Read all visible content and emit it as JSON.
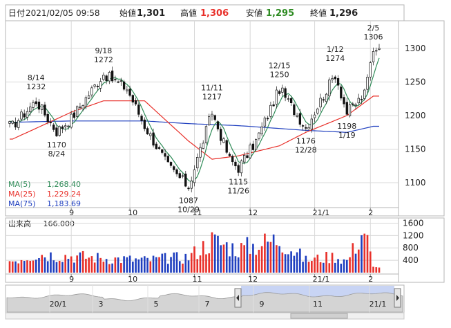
{
  "header": {
    "date_label": "日付",
    "datetime": "2021/02/05 09:58",
    "open_label": "始値",
    "open": "1,301",
    "high_label": "高値",
    "high": "1,306",
    "low_label": "安値",
    "low": "1,295",
    "close_label": "終値",
    "close": "1,296"
  },
  "legend": [
    {
      "label": "MA(5)",
      "value": "1,268.40",
      "color": "#2e8b57"
    },
    {
      "label": "MA(25)",
      "value": "1,229.24",
      "color": "#e8302a"
    },
    {
      "label": "MA(75)",
      "value": "1,183.69",
      "color": "#1f3fbf"
    }
  ],
  "volume_panel": {
    "title": "出来高",
    "value": "166.000"
  },
  "navigator": {
    "labels": [
      "20/1",
      "3",
      "5",
      "7",
      "9",
      "11",
      "21/1"
    ]
  },
  "colors": {
    "up": "#e8302a",
    "down": "#1f3fbf",
    "ma5": "#2e8b57",
    "ma25": "#e8302a",
    "ma75": "#1f3fbf",
    "frame": "#b4b4b4",
    "grid": "#d8d8d8"
  },
  "chart_data": [
    {
      "type": "candlestick",
      "x_ticks": [
        "9",
        "10",
        "11",
        "12",
        "21/1",
        "2"
      ],
      "y_ticks": [
        1100,
        1150,
        1200,
        1250,
        1300
      ],
      "ylim": [
        1065,
        1335
      ],
      "annotations": [
        {
          "date": "8/14",
          "value": 1232,
          "text": [
            "8/14",
            "1232"
          ],
          "pos": "above"
        },
        {
          "date": "8/24",
          "value": 1170,
          "text": [
            "1170",
            "8/24"
          ],
          "pos": "below"
        },
        {
          "date": "9/18",
          "value": 1272,
          "text": [
            "9/18",
            "1272"
          ],
          "pos": "above"
        },
        {
          "date": "10/29",
          "value": 1087,
          "text": [
            "1087",
            "10/29"
          ],
          "pos": "below"
        },
        {
          "date": "11/11",
          "value": 1217,
          "text": [
            "11/11",
            "1217"
          ],
          "pos": "above"
        },
        {
          "date": "11/26",
          "value": 1115,
          "text": [
            "1115",
            "11/26"
          ],
          "pos": "below"
        },
        {
          "date": "12/15",
          "value": 1250,
          "text": [
            "12/15",
            "1250"
          ],
          "pos": "above"
        },
        {
          "date": "12/28",
          "value": 1176,
          "text": [
            "1176",
            "12/28"
          ],
          "pos": "below"
        },
        {
          "date": "1/12",
          "value": 1274,
          "text": [
            "1/12",
            "1274"
          ],
          "pos": "above"
        },
        {
          "date": "1/19",
          "value": 1198,
          "text": [
            "1198",
            "1/19"
          ],
          "pos": "below"
        },
        {
          "date": "2/5",
          "value": 1306,
          "text": [
            "2/5",
            "1306"
          ],
          "pos": "above"
        }
      ],
      "anchors": [
        {
          "date": "8/3",
          "value": 1185
        },
        {
          "date": "8/14",
          "value": 1222
        },
        {
          "date": "8/24",
          "value": 1176
        },
        {
          "date": "9/1",
          "value": 1196
        },
        {
          "date": "9/18",
          "value": 1262
        },
        {
          "date": "9/30",
          "value": 1240
        },
        {
          "date": "10/8",
          "value": 1185
        },
        {
          "date": "10/20",
          "value": 1125
        },
        {
          "date": "10/29",
          "value": 1094
        },
        {
          "date": "11/11",
          "value": 1205
        },
        {
          "date": "11/20",
          "value": 1135
        },
        {
          "date": "11/26",
          "value": 1122
        },
        {
          "date": "12/4",
          "value": 1162
        },
        {
          "date": "12/15",
          "value": 1240
        },
        {
          "date": "12/28",
          "value": 1182
        },
        {
          "date": "1/12",
          "value": 1262
        },
        {
          "date": "1/19",
          "value": 1204
        },
        {
          "date": "1/28",
          "value": 1232
        },
        {
          "date": "2/5",
          "value": 1300
        }
      ],
      "ma25_approx": [
        {
          "date": "8/3",
          "value": 1165
        },
        {
          "date": "9/1",
          "value": 1205
        },
        {
          "date": "9/18",
          "value": 1222
        },
        {
          "date": "10/8",
          "value": 1222
        },
        {
          "date": "10/29",
          "value": 1162
        },
        {
          "date": "11/11",
          "value": 1135
        },
        {
          "date": "11/26",
          "value": 1140
        },
        {
          "date": "12/15",
          "value": 1155
        },
        {
          "date": "12/28",
          "value": 1175
        },
        {
          "date": "1/19",
          "value": 1200
        },
        {
          "date": "2/5",
          "value": 1229
        }
      ],
      "ma75_approx": [
        {
          "date": "8/3",
          "value": 1190
        },
        {
          "date": "9/1",
          "value": 1192
        },
        {
          "date": "10/8",
          "value": 1192
        },
        {
          "date": "10/29",
          "value": 1188
        },
        {
          "date": "11/26",
          "value": 1185
        },
        {
          "date": "12/28",
          "value": 1178
        },
        {
          "date": "1/19",
          "value": 1175
        },
        {
          "date": "2/5",
          "value": 1184
        }
      ]
    },
    {
      "type": "bar",
      "series": "volume",
      "y_ticks": [
        400,
        800,
        1200,
        1600
      ],
      "ylim": [
        0,
        1700
      ],
      "anchors": [
        {
          "date": "8/3",
          "value": 420
        },
        {
          "date": "8/14",
          "value": 650
        },
        {
          "date": "9/18",
          "value": 500
        },
        {
          "date": "10/8",
          "value": 430
        },
        {
          "date": "10/29",
          "value": 540
        },
        {
          "date": "11/11",
          "value": 1100
        },
        {
          "date": "11/26",
          "value": 800
        },
        {
          "date": "12/15",
          "value": 1150
        },
        {
          "date": "12/28",
          "value": 430
        },
        {
          "date": "1/12",
          "value": 560
        },
        {
          "date": "1/19",
          "value": 400
        },
        {
          "date": "1/28",
          "value": 1500
        },
        {
          "date": "2/5",
          "value": 166
        }
      ]
    }
  ]
}
